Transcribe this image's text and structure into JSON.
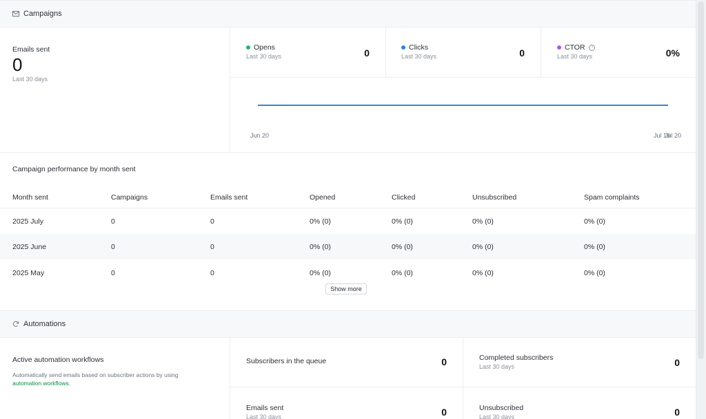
{
  "campaigns": {
    "title": "Campaigns",
    "emails_sent": {
      "label": "Emails sent",
      "value": "0",
      "period": "Last 30 days"
    },
    "stats": [
      {
        "label": "Opens",
        "period": "Last 30 days",
        "value": "0",
        "color": "#1fb86a"
      },
      {
        "label": "Clicks",
        "period": "Last 30 days",
        "value": "0",
        "color": "#2f80ed"
      },
      {
        "label": "CTOR",
        "period": "Last 30 days",
        "value": "0%",
        "color": "#a855f7"
      }
    ],
    "chart_data": {
      "type": "line",
      "x": [
        "Jun 20",
        "Jul 19",
        "Jul 20"
      ],
      "series": [
        {
          "values": [
            0,
            0,
            0
          ],
          "color": "#3a86c8"
        }
      ],
      "xlabel": "",
      "ylabel": ""
    }
  },
  "performance": {
    "title": "Campaign performance by month sent",
    "columns": [
      "Month sent",
      "Campaigns",
      "Emails sent",
      "Opened",
      "Clicked",
      "Unsubscribed",
      "Spam complaints"
    ],
    "rows": [
      [
        "2025 July",
        "0",
        "0",
        "0% (0)",
        "0% (0)",
        "0% (0)",
        "0% (0)"
      ],
      [
        "2025 June",
        "0",
        "0",
        "0% (0)",
        "0% (0)",
        "0% (0)",
        "0% (0)"
      ],
      [
        "2025 May",
        "0",
        "0",
        "0% (0)",
        "0% (0)",
        "0% (0)",
        "0% (0)"
      ]
    ],
    "show_more_label": "Show more"
  },
  "automations": {
    "title": "Automations",
    "active": {
      "title": "Active automation workflows",
      "desc_prefix": "Automatically send emails based on subscriber actions by using",
      "link_text": "automation workflows",
      "desc_suffix": "."
    },
    "queue": {
      "label": "Subscribers in the queue",
      "value": "0"
    },
    "completed": {
      "label": "Completed subscribers",
      "period": "Last 30 days",
      "value": "0"
    },
    "emails_sent": {
      "label": "Emails sent",
      "period": "Last 30 days",
      "value": "0"
    },
    "unsubscribed": {
      "label": "Unsubscribed",
      "period": "Last 30 days",
      "value": "0"
    }
  }
}
